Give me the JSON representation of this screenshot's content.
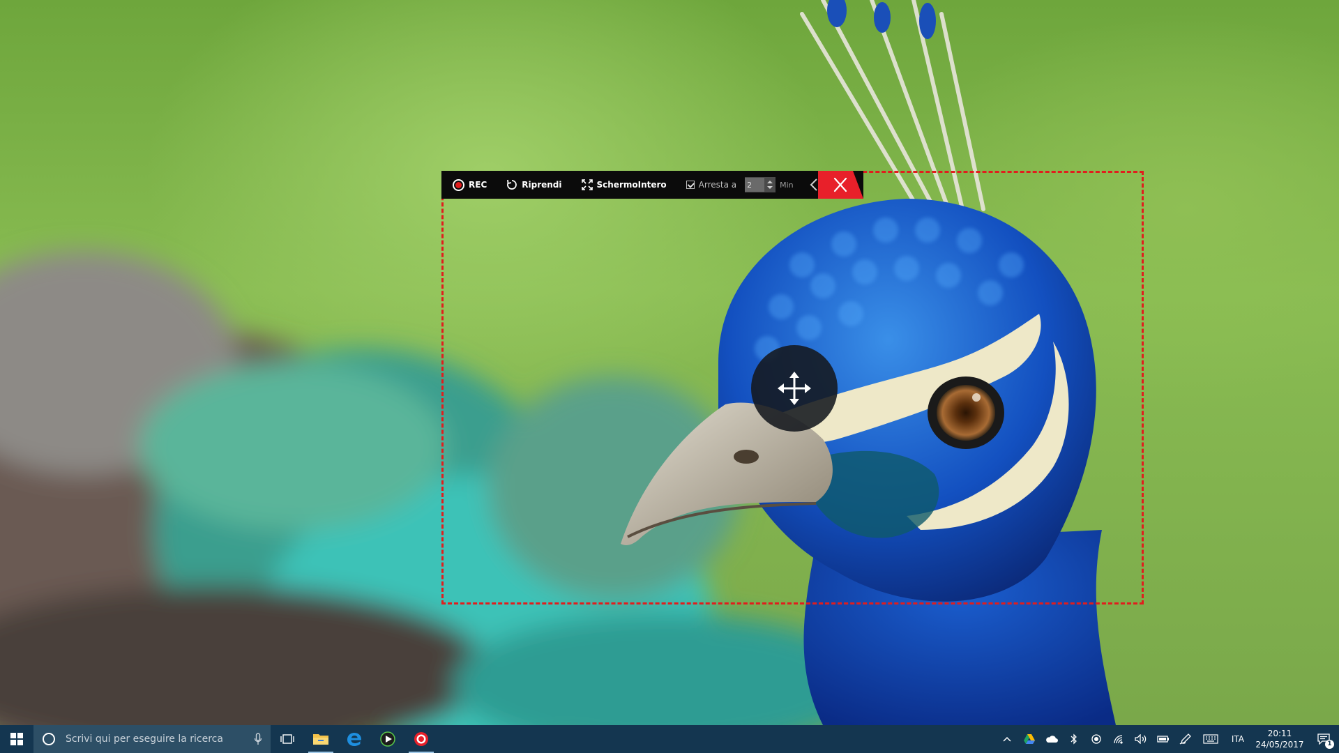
{
  "toolbar": {
    "rec_label": "REC",
    "resume_label": "Riprendi",
    "fullscreen_label": "SchermoIntero",
    "stop_at_label": "Arresta a",
    "stop_at_checked": true,
    "minutes_value": "2",
    "minutes_unit": "Min"
  },
  "taskbar": {
    "search_placeholder": "Scrivi qui per eseguire la ricerca",
    "pinned_apps": [
      "file-explorer-icon",
      "edge-icon",
      "media-player-icon",
      "screen-recorder-icon"
    ],
    "language": "ITA",
    "time": "20:11",
    "date": "24/05/2017",
    "notification_count": "1"
  },
  "colors": {
    "capture_border": "#e11d1d",
    "close_button": "#e8202a",
    "toolbar_bg": "#0b0b0b",
    "taskbar_bg": "#143650"
  }
}
